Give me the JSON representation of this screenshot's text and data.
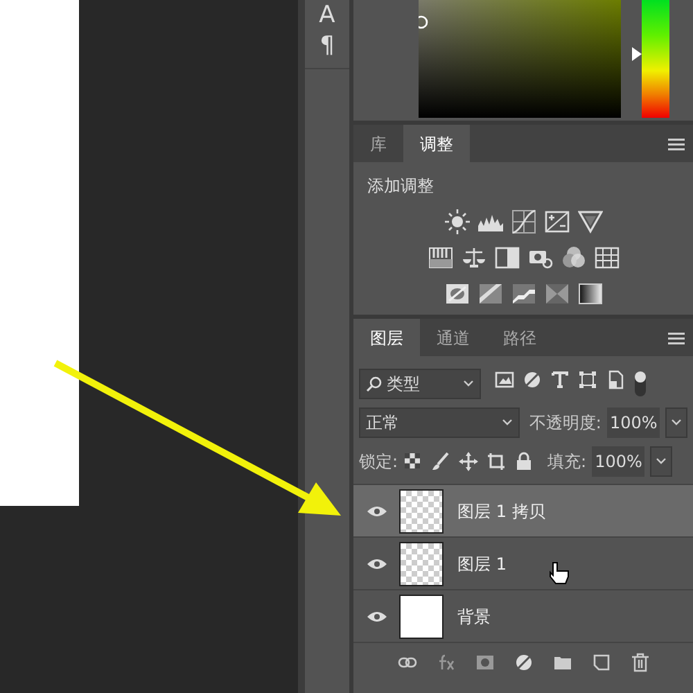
{
  "tool_column": [
    "A",
    "¶"
  ],
  "color_panel": {
    "hue_slider": {
      "level": 0.54
    }
  },
  "adjustments_panel": {
    "tabs": [
      {
        "label": "库",
        "selected": false
      },
      {
        "label": "调整",
        "selected": true
      }
    ],
    "title": "添加调整"
  },
  "layers_panel": {
    "tabs": [
      {
        "label": "图层",
        "selected": true
      },
      {
        "label": "通道",
        "selected": false
      },
      {
        "label": "路径",
        "selected": false
      }
    ],
    "filter": "类型",
    "blend_mode": "正常",
    "opacity_label": "不透明度:",
    "opacity": "100%",
    "lock_label": "锁定:",
    "fill_label": "填充:",
    "fill": "100%",
    "layers": [
      {
        "name": "图层 1 拷贝",
        "visible": true,
        "selected": true,
        "kind": "transparent"
      },
      {
        "name": "图层 1",
        "visible": true,
        "selected": false,
        "kind": "transparent"
      },
      {
        "name": "背景",
        "visible": true,
        "selected": false,
        "kind": "white"
      }
    ]
  }
}
